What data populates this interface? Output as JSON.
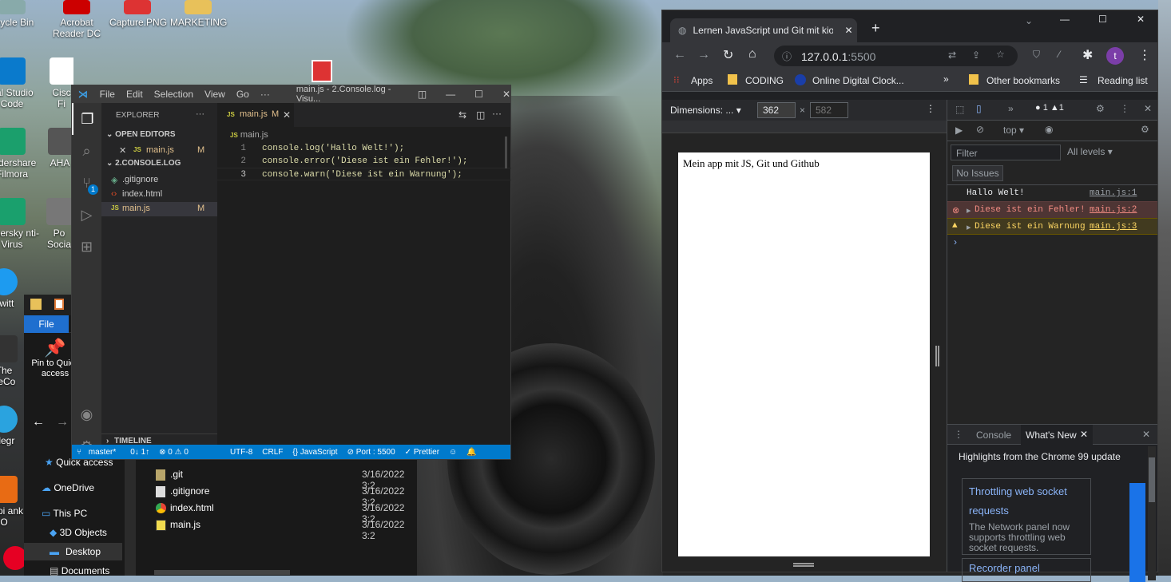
{
  "desktop": {
    "icons": [
      {
        "label": "ecycle Bin"
      },
      {
        "label": "Acrobat Reader DC"
      },
      {
        "label": "Capture.PNG"
      },
      {
        "label": "MARKETING"
      },
      {
        "label": "ual Studio Code"
      },
      {
        "label": "Cisc Fi"
      },
      {
        "label": "ondershare Filmora"
      },
      {
        "label": "AHA"
      },
      {
        "label": "aspersky nti-Virus"
      },
      {
        "label": "Po Socia"
      },
      {
        "label": "Twitt"
      },
      {
        "label": "The eeCo"
      },
      {
        "label": "elegr"
      },
      {
        "label": "ctopi ank O"
      }
    ]
  },
  "vscode": {
    "menu": [
      "File",
      "Edit",
      "Selection",
      "View",
      "Go",
      "···"
    ],
    "window_title": "main.js - 2.Console.log - Visu...",
    "explorer_title": "EXPLORER",
    "open_editors": "OPEN EDITORS",
    "open_file": "main.js",
    "open_file_badge": "M",
    "folder": "2.CONSOLE.LOG",
    "files": [
      {
        "name": ".gitignore",
        "badge": ""
      },
      {
        "name": "index.html",
        "badge": ""
      },
      {
        "name": "main.js",
        "badge": "M"
      }
    ],
    "timeline": "TIMELINE",
    "tab_label": "main.js",
    "tab_badge": "M",
    "breadcrumb": "main.js",
    "source_control_badge": "1",
    "code_lines": [
      {
        "num": "1",
        "text": "console.log('Hallo Welt!');"
      },
      {
        "num": "2",
        "text": "console.error('Diese ist ein Fehler!');"
      },
      {
        "num": "3",
        "text": "console.warn('Diese ist ein Warnung');"
      }
    ],
    "status": {
      "branch": "master*",
      "sync": "0↓ 1↑",
      "problems": "⊗ 0 ⚠ 0",
      "encoding": "UTF-8",
      "eol": "CRLF",
      "language": "{} JavaScript",
      "port": "⊘ Port : 5500",
      "prettier": "✓ Prettier"
    }
  },
  "file_explorer": {
    "ribbon_tab": "File",
    "pin_label": "Pin to Quick access",
    "nav": [
      "Quick access",
      "OneDrive",
      "This PC",
      "3D Objects",
      "Desktop",
      "Documents"
    ],
    "files": [
      {
        "name": ".git",
        "date": "3/16/2022 3:2"
      },
      {
        "name": ".gitignore",
        "date": "3/16/2022 3:2"
      },
      {
        "name": "index.html",
        "date": "3/16/2022 3:2"
      },
      {
        "name": "main.js",
        "date": "3/16/2022 3:2"
      }
    ]
  },
  "chrome": {
    "tab_title": "Lernen JavaScript und Git mit kio",
    "url_host": "127.0.0.1",
    "url_port": ":5500",
    "profile_initial": "t",
    "bookmarks": [
      "Apps",
      "CODING",
      "Online Digital Clock..."
    ],
    "other_bookmarks": "Other bookmarks",
    "reading_list": "Reading list",
    "device_toolbar": {
      "dimensions": "Dimensions: ...",
      "width": "362",
      "height": "582"
    },
    "page_text": "Mein app mit JS, Git und Github",
    "devtools": {
      "error_count": "1",
      "warn_count": "1",
      "context": "top",
      "filter_placeholder": "Filter",
      "levels": "All levels",
      "issues": "No Issues",
      "console": [
        {
          "type": "log",
          "text": "Hallo Welt!",
          "src": "main.js:1"
        },
        {
          "type": "error",
          "text": "Diese ist ein Fehler!",
          "src": "main.js:2"
        },
        {
          "type": "warn",
          "text": "Diese ist ein Warnung",
          "src": "main.js:3"
        }
      ],
      "drawer_tabs": [
        "Console",
        "What's New"
      ],
      "whats_new_heading": "Highlights from the Chrome 99 update",
      "card1_title": "Throttling web socket requests",
      "card1_body": "The Network panel now supports throttling web socket requests.",
      "card2_title": "Recorder panel"
    }
  }
}
